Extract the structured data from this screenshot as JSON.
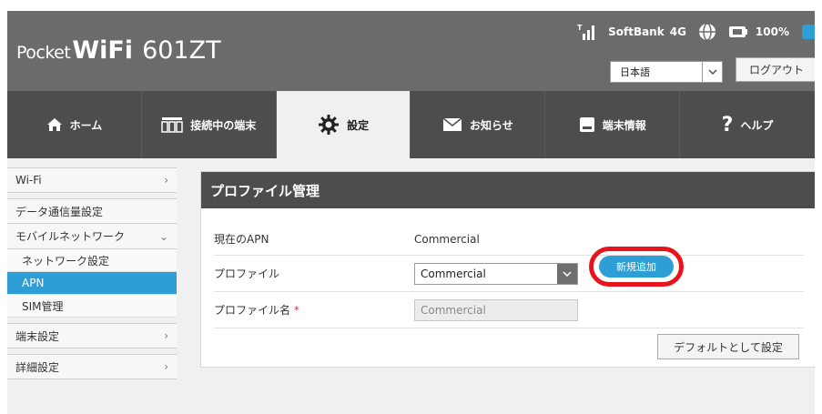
{
  "header": {
    "logo_pocket": "Pocket",
    "logo_wifi": "WiFi",
    "logo_model": "601ZT",
    "carrier": "SoftBank",
    "network": "4G",
    "battery": "100%",
    "language": "日本語",
    "logout_label": "ログアウト"
  },
  "nav": [
    {
      "label": "ホーム",
      "icon": "home-icon"
    },
    {
      "label": "接続中の端末",
      "icon": "devices-icon"
    },
    {
      "label": "設定",
      "icon": "gear-icon",
      "active": true
    },
    {
      "label": "お知らせ",
      "icon": "mail-icon"
    },
    {
      "label": "端末情報",
      "icon": "device-info-icon"
    },
    {
      "label": "ヘルプ",
      "icon": "help-icon"
    }
  ],
  "sidebar": {
    "wifi": "Wi-Fi",
    "data_usage": "データ通信量設定",
    "mobile_network": "モバイルネットワーク",
    "network_settings": "ネットワーク設定",
    "apn": "APN",
    "sim": "SIM管理",
    "device_settings": "端末設定",
    "advanced": "詳細設定"
  },
  "panel": {
    "title": "プロファイル管理",
    "current_apn_label": "現在のAPN",
    "current_apn_value": "Commercial",
    "profile_label": "プロファイル",
    "profile_value": "Commercial",
    "new_button": "新規追加",
    "profile_name_label": "プロファイル名",
    "required_mark": "*",
    "profile_name_value": "Commercial",
    "default_button": "デフォルトとして設定"
  },
  "colors": {
    "accent": "#2e9fd6",
    "header_bg": "#6b6b6b",
    "nav_bg": "#4d4d4d",
    "highlight_ring": "#e8141c"
  }
}
